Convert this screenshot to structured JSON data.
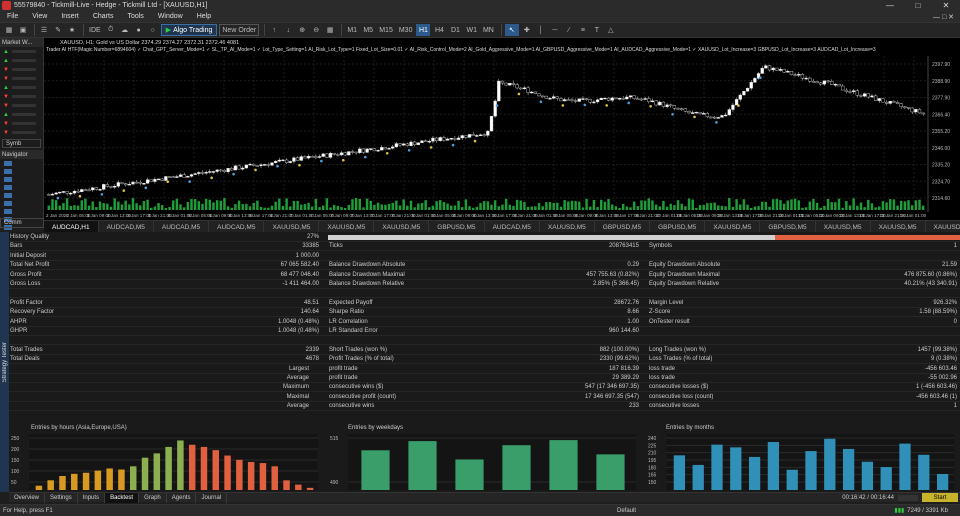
{
  "window": {
    "title": "55579840 - Tickmill-Live - Hedge - Tickmill Ltd - [XAUUSD,H1]"
  },
  "menu": [
    "File",
    "View",
    "Insert",
    "Charts",
    "Tools",
    "Window",
    "Help"
  ],
  "toolbar": {
    "ide": "IDE",
    "algo": "Algo Trading",
    "neworder": "New Order",
    "timeframes": [
      "M1",
      "M5",
      "M15",
      "M30",
      "H1",
      "H4",
      "D1",
      "W1",
      "MN"
    ],
    "active_tf": "H1"
  },
  "market_watch": {
    "title": "Market W...",
    "symbols_btn": "Symb",
    "rows": [
      "up",
      "up",
      "dn",
      "dn",
      "up",
      "dn",
      "dn",
      "up",
      "dn",
      "dn"
    ]
  },
  "navigator": {
    "title": "Navigator"
  },
  "common_btn": "Comm",
  "chart": {
    "symbol_line": "XAUUSD, H1:  Gold vs US Dollar  2374.29 2374.27 2372.31 2372.46  4081",
    "ea_line": "Trader AI HTF(Magic Number=6894604) ✓ Chat_GPT_Server_Mode=1 ✓ SL_TP_AI_Mode=1 ✓ Lot_Type_Setting=1 AI_Risk_Lot_Type=1 Fixed_Lot_Size=0.01 ✓ AI_Risk_Control_Mode=2 AI_Gold_Aggressive_Mode=1 AI_GBPUSD_Aggressive_Mode=1 AI_AUDCAD_Aggressive_Mode=1 ✓ XAUUSD_Lot_Increase=3 GBPUSD_Lot_Increase=3 AUDCAD_Lot_Increase=3",
    "price_labels": [
      "2397.90",
      "2388.90",
      "2377.90",
      "2366.40",
      "2355.20",
      "2346.00",
      "2335.20",
      "2324.70",
      "2314.60"
    ],
    "date_labels": [
      "2 Jan 2020",
      "2 Jan 05:00",
      "3 Jan 09:00",
      "3 Jan 13:00",
      "3 Jan 17:00",
      "3 Jan 21:00",
      "6 Jan 01:00",
      "6 Jan 05:00",
      "6 Jan 09:00",
      "6 Jan 13:00",
      "6 Jan 17:00",
      "6 Jan 21:00",
      "7 Jan 01:00",
      "7 Jan 05:00",
      "7 Jan 09:00",
      "7 Jan 13:00",
      "7 Jan 17:00",
      "7 Jan 21:00",
      "8 Jan 01:00",
      "8 Jan 05:00",
      "8 Jan 09:00",
      "8 Jan 13:00",
      "8 Jan 17:00",
      "8 Jan 21:00",
      "9 Jan 01:00",
      "9 Jan 05:00",
      "9 Jan 09:00",
      "9 Jan 13:00",
      "9 Jan 17:00",
      "9 Jan 21:00",
      "10 Jan 01:00",
      "10 Jan 05:00",
      "10 Jan 09:00",
      "10 Jan 13:00",
      "10 Jan 17:00",
      "10 Jan 21:00",
      "13 Jan 01:00",
      "13 Jan 05:00",
      "13 Jan 09:00",
      "13 Jan 13:00",
      "13 Jan 17:00",
      "13 Jan 21:00",
      "14 Jan 01:00"
    ]
  },
  "chart_tabs": [
    "AUDCAD,H1",
    "AUDCAD,M5",
    "AUDCAD,M5",
    "AUDCAD,M5",
    "XAUUSD,M5",
    "XAUUSD,M5",
    "XAUUSD,M5",
    "GBPUSD,M5",
    "AUDCAD,M5",
    "XAUUSD,M5",
    "GBPUSD,M5",
    "GBPUSD,M5",
    "XAUUSD,M5",
    "GBPUSD,M5",
    "XAUUSD,M5",
    "XAUUSD,M5",
    "XAUUSD,M5",
    "GBPUSD,M5",
    "GBPUSD,M5"
  ],
  "tester": {
    "side_label": "Strategy Tester",
    "col1": [
      {
        "l": "History Quality",
        "v": "27%"
      },
      {
        "l": "Bars",
        "v": "33385"
      },
      {
        "l": "Initial Deposit",
        "v": "1 000.00"
      },
      {
        "l": "Total Net Profit",
        "v": "67 065 582.40"
      },
      {
        "l": "Gross Profit",
        "v": "68 477 046.40"
      },
      {
        "l": "Gross Loss",
        "v": "-1 411 464.00"
      },
      {
        "l": "",
        "": ""
      },
      {
        "l": "Profit Factor",
        "v": "48.51"
      },
      {
        "l": "Recovery Factor",
        "v": "140.64"
      },
      {
        "l": "AHPR",
        "v": "1.0048 (0.48%)"
      },
      {
        "l": "GHPR",
        "v": "1.0048 (0.48%)"
      },
      {
        "l": "",
        "v": ""
      },
      {
        "l": "Total Trades",
        "v": "2339"
      },
      {
        "l": "Total Deals",
        "v": "4678"
      },
      {
        "l": "Largest",
        "v": "profit trade"
      },
      {
        "l": "Average",
        "v": "profit trade"
      },
      {
        "l": "Maximum",
        "v": "consecutive wins ($)"
      },
      {
        "l": "Maximal",
        "v": "consecutive profit (count)"
      },
      {
        "l": "Average",
        "v": "consecutive wins"
      }
    ],
    "col2": [
      {
        "l": "",
        "v": ""
      },
      {
        "l": "Ticks",
        "v": "208763415"
      },
      {
        "l": "",
        "v": ""
      },
      {
        "l": "Balance Drawdown Absolute",
        "v": "0.29"
      },
      {
        "l": "Balance Drawdown Maximal",
        "v": "457 755.63 (0.82%)"
      },
      {
        "l": "Balance Drawdown Relative",
        "v": "2.85% (5 366.45)"
      },
      {
        "l": "",
        "v": ""
      },
      {
        "l": "Expected Payoff",
        "v": "28672.76"
      },
      {
        "l": "Sharpe Ratio",
        "v": "8.66"
      },
      {
        "l": "LR Correlation",
        "v": "1.00"
      },
      {
        "l": "LR Standard Error",
        "v": "960 144.60"
      },
      {
        "l": "",
        "v": ""
      },
      {
        "l": "Short Trades (won %)",
        "v": "882 (100.00%)"
      },
      {
        "l": "Profit Trades (% of total)",
        "v": "2330 (99.62%)"
      },
      {
        "l": "profit trade",
        "v": "187 816.39"
      },
      {
        "l": "profit trade",
        "v": "29 389.29"
      },
      {
        "l": "consecutive wins ($)",
        "v": "547 (17 346 697.35)"
      },
      {
        "l": "consecutive profit (count)",
        "v": "17 346 697.35 (547)"
      },
      {
        "l": "consecutive wins",
        "v": "233"
      }
    ],
    "col3": [
      {
        "l": "",
        "v": ""
      },
      {
        "l": "Symbols",
        "v": "1"
      },
      {
        "l": "",
        "v": ""
      },
      {
        "l": "Equity Drawdown Absolute",
        "v": "21.59"
      },
      {
        "l": "Equity Drawdown Maximal",
        "v": "476 875.60 (0.86%)"
      },
      {
        "l": "Equity Drawdown Relative",
        "v": "40.21% (43 340.91)"
      },
      {
        "l": "",
        "v": ""
      },
      {
        "l": "Margin Level",
        "v": "926.32%"
      },
      {
        "l": "Z-Score",
        "v": "1.58 (88.59%)"
      },
      {
        "l": "OnTester result",
        "v": "0"
      },
      {
        "l": "",
        "v": ""
      },
      {
        "l": "",
        "v": ""
      },
      {
        "l": "Long Trades (won %)",
        "v": "1457 (99.38%)"
      },
      {
        "l": "Loss Trades (% of total)",
        "v": "9 (0.38%)"
      },
      {
        "l": "loss trade",
        "v": "-456 603.46"
      },
      {
        "l": "loss trade",
        "v": "-55 002.96"
      },
      {
        "l": "consecutive losses ($)",
        "v": "1 (-456 603.46)"
      },
      {
        "l": "consecutive loss (count)",
        "v": "-456 603.46 (1)"
      },
      {
        "l": "consecutive losses",
        "v": "1"
      }
    ],
    "history_quality": 0.27
  },
  "chart_data": [
    {
      "type": "bar",
      "title": "Entries by hours (Asia,Europe,USA)",
      "y_ticks": [
        "250",
        "200",
        "150",
        "100",
        "50"
      ],
      "ylim": [
        0,
        260
      ],
      "values": [
        20,
        45,
        65,
        75,
        80,
        90,
        100,
        95,
        110,
        150,
        170,
        200,
        230,
        210,
        200,
        185,
        160,
        140,
        130,
        125,
        110,
        45,
        25,
        10
      ],
      "colors": [
        "#d89a20",
        "#d89a20",
        "#d89a20",
        "#d89a20",
        "#d89a20",
        "#d89a20",
        "#d89a20",
        "#d89a20",
        "#8cb050",
        "#8cb050",
        "#8cb050",
        "#8cb050",
        "#8cb050",
        "#e06040",
        "#e06040",
        "#e06040",
        "#e06040",
        "#e06040",
        "#e06040",
        "#e06040",
        "#e06040",
        "#e06040",
        "#e06040",
        "#e06040"
      ]
    },
    {
      "type": "bar",
      "title": "Entries by weekdays",
      "y_ticks": [
        "515",
        "490"
      ],
      "ylim": [
        470,
        525
      ],
      "values": [
        509,
        518,
        500,
        514,
        519,
        505
      ],
      "colors": [
        "#3a9e6a",
        "#3a9e6a",
        "#3a9e6a",
        "#3a9e6a",
        "#3a9e6a",
        "#3a9e6a"
      ]
    },
    {
      "type": "bar",
      "title": "Entries by months",
      "y_ticks": [
        "240",
        "225",
        "210",
        "195",
        "180",
        "165",
        "150"
      ],
      "ylim": [
        145,
        250
      ],
      "values": [
        210,
        192,
        230,
        225,
        207,
        235,
        183,
        218,
        241,
        222,
        198,
        188,
        232,
        211,
        175
      ],
      "colors": [
        "#3090b8",
        "#3090b8",
        "#3090b8",
        "#3090b8",
        "#3090b8",
        "#3090b8",
        "#3090b8",
        "#3090b8",
        "#3090b8",
        "#3090b8",
        "#3090b8",
        "#3090b8",
        "#3090b8",
        "#3090b8",
        "#3090b8"
      ]
    }
  ],
  "bottom_tabs": [
    "Overview",
    "Settings",
    "Inputs",
    "Backtest",
    "Graph",
    "Agents",
    "Journal"
  ],
  "active_bottom_tab": "Backtest",
  "time_info": "00:16:42 / 00:16:44",
  "start_label": "Start",
  "status": {
    "help": "For Help, press F1",
    "profile": "Default",
    "traffic": "7249 / 3391 Kb"
  }
}
